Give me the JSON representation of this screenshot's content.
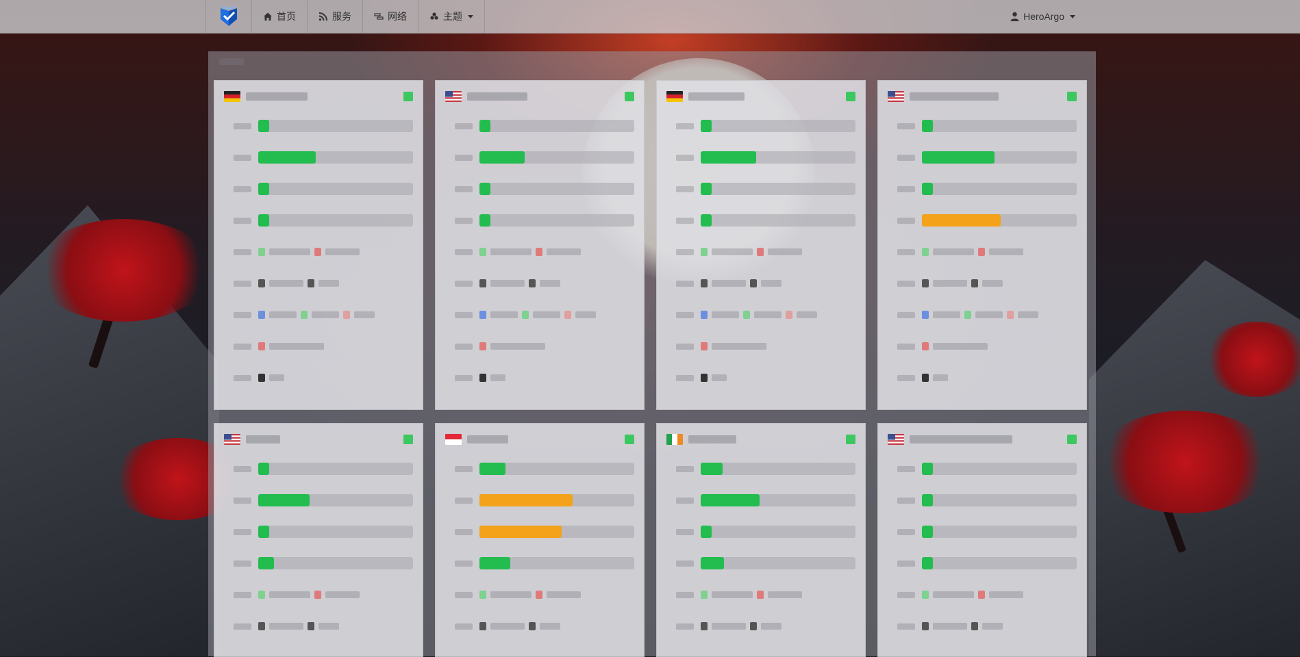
{
  "theme": {
    "ok_color": "#22bd4e",
    "warn_color": "#f3a21a",
    "status_color": "#3cc760"
  },
  "navbar": {
    "brand_icon": "shield-check-logo-icon",
    "items": [
      {
        "label": "首页",
        "icon": "home-icon"
      },
      {
        "label": "服务",
        "icon": "rss-icon"
      },
      {
        "label": "网络",
        "icon": "network-icon"
      },
      {
        "label": "主题",
        "icon": "theme-icon",
        "dropdown": true
      }
    ],
    "user": {
      "label": "HeroArgo",
      "icon": "user-icon",
      "dropdown": true
    }
  },
  "board": {
    "cards": [
      {
        "flag": "de",
        "status": "online",
        "bars": [
          {
            "level": 0.05,
            "state": "ok"
          },
          {
            "level": 0.37,
            "state": "ok"
          },
          {
            "level": 0.05,
            "state": "ok"
          },
          {
            "level": 0.05,
            "state": "ok"
          }
        ]
      },
      {
        "flag": "us",
        "status": "online",
        "bars": [
          {
            "level": 0.05,
            "state": "ok"
          },
          {
            "level": 0.29,
            "state": "ok"
          },
          {
            "level": 0.05,
            "state": "ok"
          },
          {
            "level": 0.05,
            "state": "ok"
          }
        ]
      },
      {
        "flag": "de",
        "status": "online",
        "bars": [
          {
            "level": 0.05,
            "state": "ok"
          },
          {
            "level": 0.36,
            "state": "ok"
          },
          {
            "level": 0.05,
            "state": "ok"
          },
          {
            "level": 0.05,
            "state": "ok"
          }
        ]
      },
      {
        "flag": "us",
        "status": "online",
        "bars": [
          {
            "level": 0.05,
            "state": "ok"
          },
          {
            "level": 0.47,
            "state": "ok"
          },
          {
            "level": 0.05,
            "state": "ok"
          },
          {
            "level": 0.51,
            "state": "warn"
          }
        ]
      },
      {
        "flag": "us",
        "status": "online",
        "bars": [
          {
            "level": 0.05,
            "state": "ok"
          },
          {
            "level": 0.33,
            "state": "ok"
          },
          {
            "level": 0.05,
            "state": "ok"
          },
          {
            "level": 0.1,
            "state": "ok"
          }
        ]
      },
      {
        "flag": "sg",
        "status": "online",
        "bars": [
          {
            "level": 0.17,
            "state": "ok"
          },
          {
            "level": 0.6,
            "state": "warn"
          },
          {
            "level": 0.53,
            "state": "warn"
          },
          {
            "level": 0.2,
            "state": "ok"
          }
        ]
      },
      {
        "flag": "ie",
        "status": "online",
        "bars": [
          {
            "level": 0.14,
            "state": "ok"
          },
          {
            "level": 0.38,
            "state": "ok"
          },
          {
            "level": 0.05,
            "state": "ok"
          },
          {
            "level": 0.15,
            "state": "ok"
          }
        ]
      },
      {
        "flag": "us",
        "status": "online",
        "bars": [
          {
            "level": 0.05,
            "state": "ok"
          },
          {
            "level": 0.05,
            "state": "ok"
          },
          {
            "level": 0.05,
            "state": "ok"
          },
          {
            "level": 0.05,
            "state": "ok"
          }
        ]
      }
    ]
  }
}
